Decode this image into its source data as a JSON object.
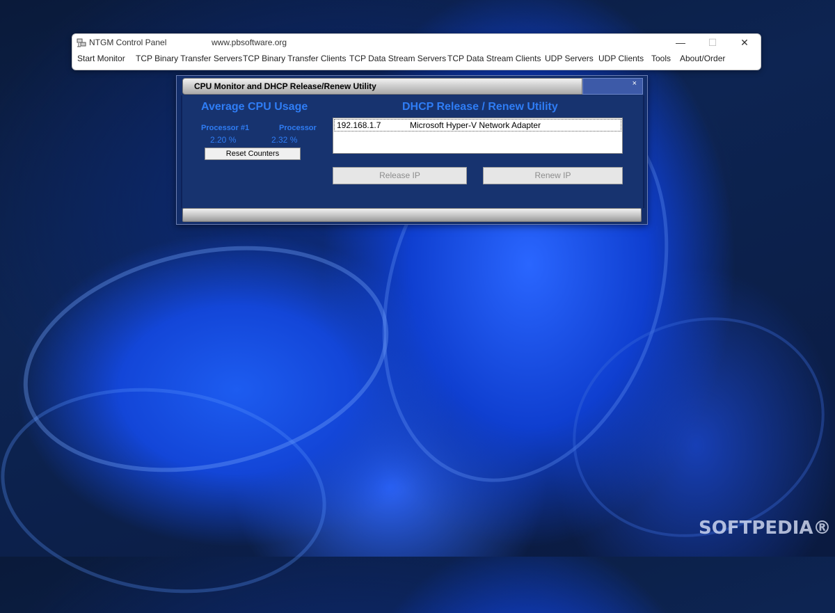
{
  "main_window": {
    "title": "NTGM Control Panel",
    "url": "www.pbsoftware.org",
    "controls": {
      "minimize": "—",
      "maximize": "☐",
      "close": "✕"
    },
    "menu": [
      "Start Monitor",
      "TCP Binary Transfer Servers",
      "TCP Binary Transfer Clients",
      "TCP Data Stream Servers",
      "TCP Data Stream Clients",
      "UDP Servers",
      "UDP Clients",
      "Tools",
      "About/Order"
    ]
  },
  "utility_window": {
    "title": "CPU Monitor and DHCP Release/Renew Utility",
    "close": "×",
    "cpu": {
      "heading": "Average CPU Usage",
      "processors": [
        {
          "label": "Processor #1",
          "value": "2.20 %"
        },
        {
          "label": "Processor",
          "value": "2.32 %"
        }
      ],
      "reset_label": "Reset Counters"
    },
    "dhcp": {
      "heading": "DHCP Release / Renew Utility",
      "adapters": [
        {
          "ip": "192.168.1.7",
          "name": "Microsoft Hyper-V Network Adapter"
        }
      ],
      "release_label": "Release IP",
      "renew_label": "Renew IP"
    }
  },
  "watermark": "SOFTPEDIA®"
}
